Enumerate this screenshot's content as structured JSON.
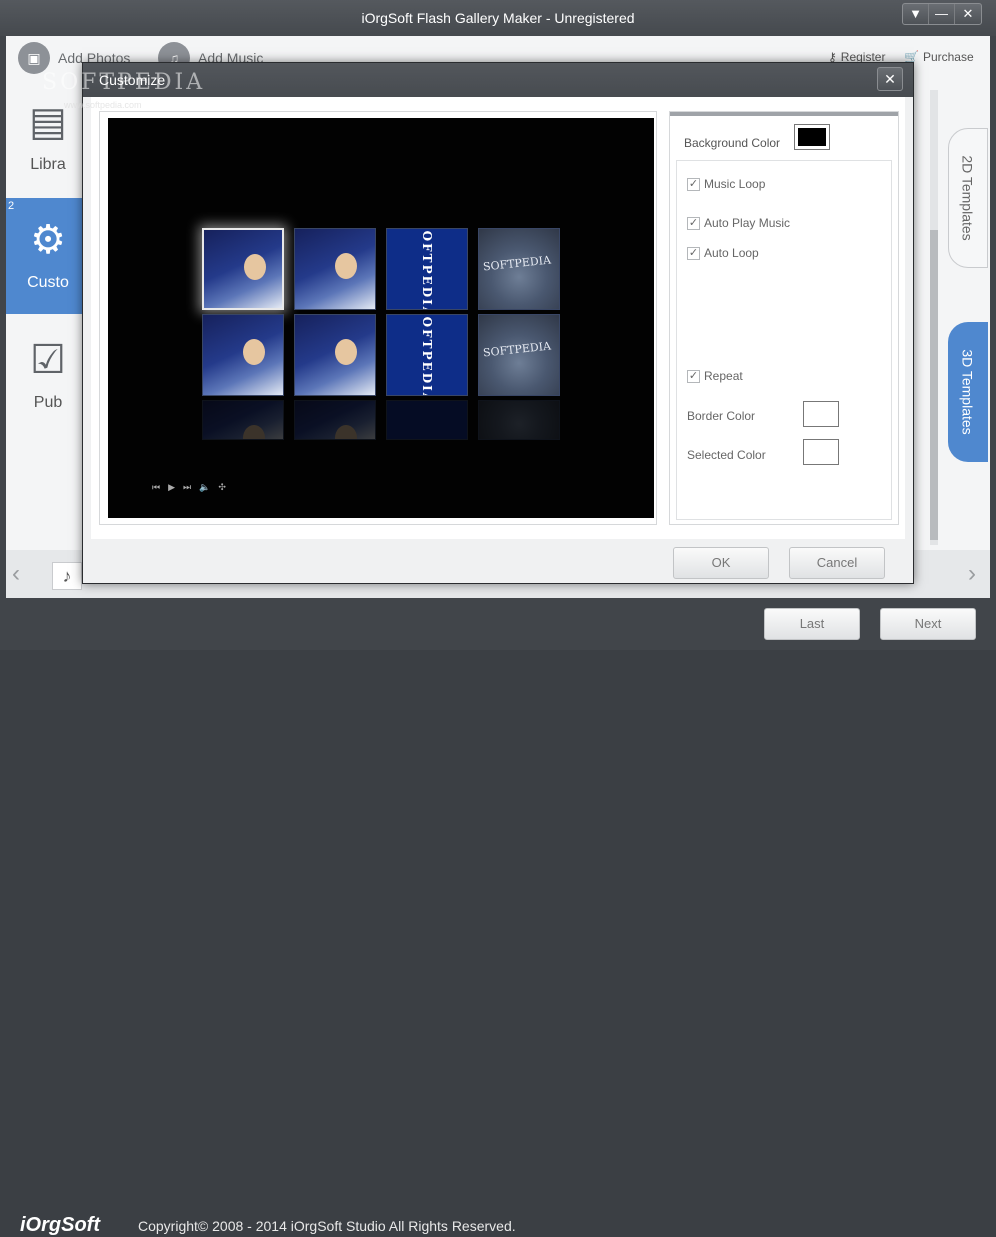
{
  "window": {
    "title": "iOrgSoft Flash Gallery Maker - Unregistered",
    "controls": [
      "▼",
      "—",
      "✕"
    ]
  },
  "toolbar": {
    "add_photos": "Add Photos",
    "add_music": "Add Music",
    "register": "Register",
    "purchase": "Purchase"
  },
  "watermark": {
    "text": "SOFTPEDIA",
    "sub": "www.softpedia.com"
  },
  "sidebar": {
    "items": [
      {
        "label": "Libra"
      },
      {
        "label": "Custo",
        "step": "2"
      },
      {
        "label": "Pub"
      }
    ]
  },
  "tabs": {
    "t2d": "2D Templates",
    "t3d": "3D Templates"
  },
  "dialog": {
    "title": "Customize",
    "preview": {
      "tile_text": "SOFTPEDIA",
      "controls": [
        "⏮",
        "▶",
        "⏭",
        "🔈",
        "✣"
      ]
    },
    "settings": {
      "background_color_label": "Background Color",
      "background_color": "#000000",
      "music_loop": "Music Loop",
      "auto_play_music": "Auto Play Music",
      "auto_loop": "Auto Loop",
      "repeat": "Repeat",
      "border_color_label": "Border Color",
      "border_color": "#ffffff",
      "selected_color_label": "Selected Color",
      "selected_color": "#ffffff"
    },
    "ok": "OK",
    "cancel": "Cancel"
  },
  "footer": {
    "logo": "iOrgSoft",
    "copyright": "Copyright© 2008 - 2014 iOrgSoft Studio All Rights Reserved.",
    "last": "Last",
    "next": "Next"
  },
  "colors": {
    "accent": "#4f88cf",
    "chrome": "#41454a"
  }
}
